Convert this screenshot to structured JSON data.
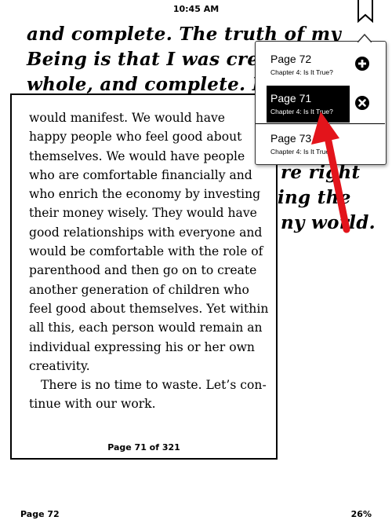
{
  "status_bar": {
    "time": "10:45 AM"
  },
  "background_page": {
    "lines": [
      "and complete. The truth of my",
      "Being is that I was creat",
      "whole, and complete. I",
      "",
      "",
      "re right",
      "ing the",
      "ny world."
    ]
  },
  "preview": {
    "lines": [
      "would manifest. We would have",
      "happy people who feel good about",
      "themselves. We would have people",
      "who are comfortable financially and",
      "who enrich the economy by investing",
      "their money wisely. They would have",
      "good relationships with everyone and",
      "would be comfortable with the role of",
      "parenthood and then go on to create",
      "another generation of children who",
      "feel good about themselves. Yet within",
      "all this, each person would remain an",
      "individual expressing his or her own",
      "creativity.",
      "There is no time to waste. Let’s con-",
      "tinue with our work."
    ],
    "footer": "Page 71 of 321"
  },
  "popup": {
    "items": [
      {
        "title": "Page 72",
        "subtitle": "Chapter 4: Is It True?",
        "icon": "plus-circle-icon"
      },
      {
        "title": "Page 71",
        "subtitle": "Chapter 4: Is It True?",
        "icon": "x-circle-icon"
      },
      {
        "title": "Page 73",
        "subtitle": "Chapter 4: Is It True?",
        "icon": ""
      }
    ]
  },
  "footer": {
    "location": "Page 72",
    "progress": "26%"
  },
  "colors": {
    "annotation_arrow": "#e3141b",
    "selected_bg": "#000000"
  }
}
